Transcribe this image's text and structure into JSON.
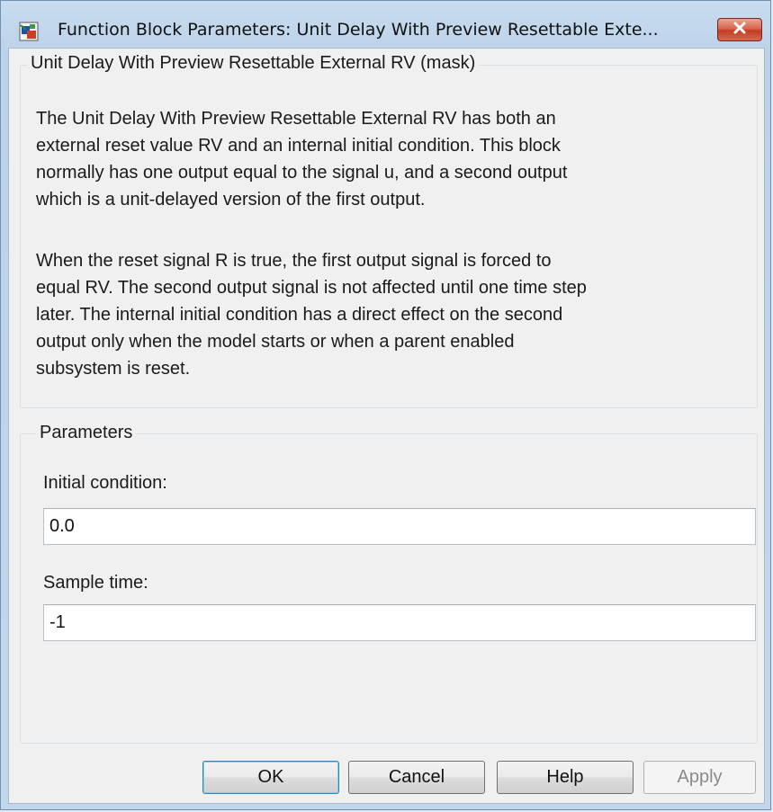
{
  "window": {
    "title": "Function Block Parameters: Unit Delay With Preview Resettable Exte...",
    "icon": "simulink-block-icon",
    "close_icon": "close-icon"
  },
  "mask": {
    "legend": "Unit Delay With Preview Resettable External RV (mask)",
    "paragraph1": "The Unit Delay With Preview Resettable External RV has both an\nexternal reset value RV and an internal initial condition.  This block\nnormally has one output equal to the signal u, and a second output\nwhich is a unit-delayed version of the first output.",
    "paragraph2": "When the reset signal R is true, the first output signal is forced to\nequal RV. The second output signal is not affected until one time step\nlater. The internal initial condition has a direct effect on the second\noutput only when the model starts or when a parent enabled\nsubsystem is reset."
  },
  "parameters": {
    "legend": "Parameters",
    "initial_condition": {
      "label": "Initial condition:",
      "value": "0.0"
    },
    "sample_time": {
      "label": "Sample time:",
      "value": "-1"
    }
  },
  "buttons": {
    "ok": "OK",
    "cancel": "Cancel",
    "help": "Help",
    "apply": "Apply"
  },
  "colors": {
    "close_button": "#c94a32",
    "default_button_border": "#3c7fb1"
  }
}
